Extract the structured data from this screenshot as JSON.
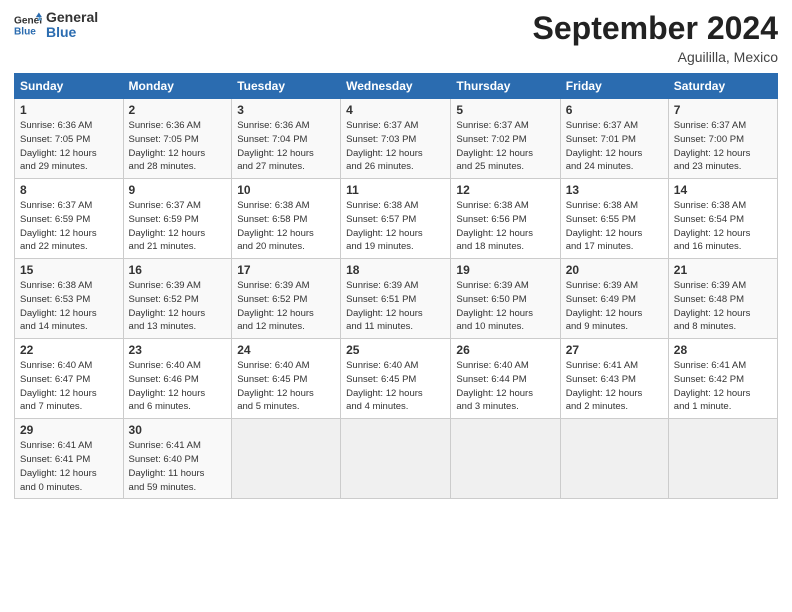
{
  "header": {
    "logo_general": "General",
    "logo_blue": "Blue",
    "month_title": "September 2024",
    "location": "Aguililla, Mexico"
  },
  "days_of_week": [
    "Sunday",
    "Monday",
    "Tuesday",
    "Wednesday",
    "Thursday",
    "Friday",
    "Saturday"
  ],
  "weeks": [
    [
      {
        "day": "1",
        "info": "Sunrise: 6:36 AM\nSunset: 7:05 PM\nDaylight: 12 hours\nand 29 minutes."
      },
      {
        "day": "2",
        "info": "Sunrise: 6:36 AM\nSunset: 7:05 PM\nDaylight: 12 hours\nand 28 minutes."
      },
      {
        "day": "3",
        "info": "Sunrise: 6:36 AM\nSunset: 7:04 PM\nDaylight: 12 hours\nand 27 minutes."
      },
      {
        "day": "4",
        "info": "Sunrise: 6:37 AM\nSunset: 7:03 PM\nDaylight: 12 hours\nand 26 minutes."
      },
      {
        "day": "5",
        "info": "Sunrise: 6:37 AM\nSunset: 7:02 PM\nDaylight: 12 hours\nand 25 minutes."
      },
      {
        "day": "6",
        "info": "Sunrise: 6:37 AM\nSunset: 7:01 PM\nDaylight: 12 hours\nand 24 minutes."
      },
      {
        "day": "7",
        "info": "Sunrise: 6:37 AM\nSunset: 7:00 PM\nDaylight: 12 hours\nand 23 minutes."
      }
    ],
    [
      {
        "day": "8",
        "info": "Sunrise: 6:37 AM\nSunset: 6:59 PM\nDaylight: 12 hours\nand 22 minutes."
      },
      {
        "day": "9",
        "info": "Sunrise: 6:37 AM\nSunset: 6:59 PM\nDaylight: 12 hours\nand 21 minutes."
      },
      {
        "day": "10",
        "info": "Sunrise: 6:38 AM\nSunset: 6:58 PM\nDaylight: 12 hours\nand 20 minutes."
      },
      {
        "day": "11",
        "info": "Sunrise: 6:38 AM\nSunset: 6:57 PM\nDaylight: 12 hours\nand 19 minutes."
      },
      {
        "day": "12",
        "info": "Sunrise: 6:38 AM\nSunset: 6:56 PM\nDaylight: 12 hours\nand 18 minutes."
      },
      {
        "day": "13",
        "info": "Sunrise: 6:38 AM\nSunset: 6:55 PM\nDaylight: 12 hours\nand 17 minutes."
      },
      {
        "day": "14",
        "info": "Sunrise: 6:38 AM\nSunset: 6:54 PM\nDaylight: 12 hours\nand 16 minutes."
      }
    ],
    [
      {
        "day": "15",
        "info": "Sunrise: 6:38 AM\nSunset: 6:53 PM\nDaylight: 12 hours\nand 14 minutes."
      },
      {
        "day": "16",
        "info": "Sunrise: 6:39 AM\nSunset: 6:52 PM\nDaylight: 12 hours\nand 13 minutes."
      },
      {
        "day": "17",
        "info": "Sunrise: 6:39 AM\nSunset: 6:52 PM\nDaylight: 12 hours\nand 12 minutes."
      },
      {
        "day": "18",
        "info": "Sunrise: 6:39 AM\nSunset: 6:51 PM\nDaylight: 12 hours\nand 11 minutes."
      },
      {
        "day": "19",
        "info": "Sunrise: 6:39 AM\nSunset: 6:50 PM\nDaylight: 12 hours\nand 10 minutes."
      },
      {
        "day": "20",
        "info": "Sunrise: 6:39 AM\nSunset: 6:49 PM\nDaylight: 12 hours\nand 9 minutes."
      },
      {
        "day": "21",
        "info": "Sunrise: 6:39 AM\nSunset: 6:48 PM\nDaylight: 12 hours\nand 8 minutes."
      }
    ],
    [
      {
        "day": "22",
        "info": "Sunrise: 6:40 AM\nSunset: 6:47 PM\nDaylight: 12 hours\nand 7 minutes."
      },
      {
        "day": "23",
        "info": "Sunrise: 6:40 AM\nSunset: 6:46 PM\nDaylight: 12 hours\nand 6 minutes."
      },
      {
        "day": "24",
        "info": "Sunrise: 6:40 AM\nSunset: 6:45 PM\nDaylight: 12 hours\nand 5 minutes."
      },
      {
        "day": "25",
        "info": "Sunrise: 6:40 AM\nSunset: 6:45 PM\nDaylight: 12 hours\nand 4 minutes."
      },
      {
        "day": "26",
        "info": "Sunrise: 6:40 AM\nSunset: 6:44 PM\nDaylight: 12 hours\nand 3 minutes."
      },
      {
        "day": "27",
        "info": "Sunrise: 6:41 AM\nSunset: 6:43 PM\nDaylight: 12 hours\nand 2 minutes."
      },
      {
        "day": "28",
        "info": "Sunrise: 6:41 AM\nSunset: 6:42 PM\nDaylight: 12 hours\nand 1 minute."
      }
    ],
    [
      {
        "day": "29",
        "info": "Sunrise: 6:41 AM\nSunset: 6:41 PM\nDaylight: 12 hours\nand 0 minutes."
      },
      {
        "day": "30",
        "info": "Sunrise: 6:41 AM\nSunset: 6:40 PM\nDaylight: 11 hours\nand 59 minutes."
      },
      {
        "day": "",
        "info": ""
      },
      {
        "day": "",
        "info": ""
      },
      {
        "day": "",
        "info": ""
      },
      {
        "day": "",
        "info": ""
      },
      {
        "day": "",
        "info": ""
      }
    ]
  ]
}
